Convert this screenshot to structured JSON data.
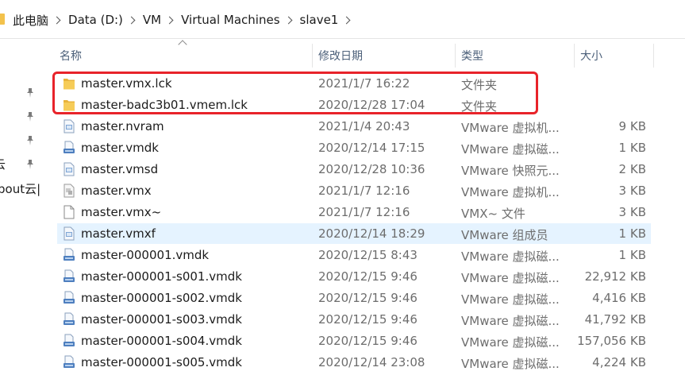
{
  "breadcrumb": [
    "此电脑",
    "Data (D:)",
    "VM",
    "Virtual Machines",
    "slave1"
  ],
  "nav_fragments": [
    "云",
    "bout云|"
  ],
  "columns": {
    "name": "名称",
    "date": "修改日期",
    "type": "类型",
    "size": "大小"
  },
  "files": [
    {
      "name": "master.vmx.lck",
      "date": "2021/1/7 16:22",
      "type": "文件夹",
      "size": "",
      "icon": "folder-icon"
    },
    {
      "name": "master-badc3b01.vmem.lck",
      "date": "2020/12/28 17:04",
      "type": "文件夹",
      "size": "",
      "icon": "folder-icon"
    },
    {
      "name": "master.nvram",
      "date": "2021/1/4 20:43",
      "type": "VMware 虚拟机...",
      "size": "9 KB",
      "icon": "vmware-file-icon"
    },
    {
      "name": "master.vmdk",
      "date": "2020/12/14 17:15",
      "type": "VMware 虚拟磁...",
      "size": "1 KB",
      "icon": "disk-file-icon"
    },
    {
      "name": "master.vmsd",
      "date": "2020/12/28 10:36",
      "type": "VMware 快照元...",
      "size": "2 KB",
      "icon": "vmware-file-icon"
    },
    {
      "name": "master.vmx",
      "date": "2021/1/7 12:16",
      "type": "VMware 虚拟机...",
      "size": "3 KB",
      "icon": "vmx-file-icon"
    },
    {
      "name": "master.vmx~",
      "date": "2021/1/7 12:16",
      "type": "VMX~ 文件",
      "size": "3 KB",
      "icon": "blank-file-icon"
    },
    {
      "name": "master.vmxf",
      "date": "2020/12/14 18:29",
      "type": "VMware 组成员",
      "size": "1 KB",
      "icon": "vmware-file-icon"
    },
    {
      "name": "master-000001.vmdk",
      "date": "2020/12/15 8:43",
      "type": "VMware 虚拟磁...",
      "size": "1 KB",
      "icon": "disk-file-icon"
    },
    {
      "name": "master-000001-s001.vmdk",
      "date": "2020/12/15 9:46",
      "type": "VMware 虚拟磁...",
      "size": "22,912 KB",
      "icon": "disk-file-icon"
    },
    {
      "name": "master-000001-s002.vmdk",
      "date": "2020/12/15 9:46",
      "type": "VMware 虚拟磁...",
      "size": "4,416 KB",
      "icon": "disk-file-icon"
    },
    {
      "name": "master-000001-s003.vmdk",
      "date": "2020/12/15 9:46",
      "type": "VMware 虚拟磁...",
      "size": "41,792 KB",
      "icon": "disk-file-icon"
    },
    {
      "name": "master-000001-s004.vmdk",
      "date": "2020/12/15 9:46",
      "type": "VMware 虚拟磁...",
      "size": "157,056 KB",
      "icon": "disk-file-icon"
    },
    {
      "name": "master-000001-s005.vmdk",
      "date": "2020/12/14 23:08",
      "type": "VMware 虚拟磁...",
      "size": "4,224 KB",
      "icon": "disk-file-icon"
    }
  ],
  "selected_row": 7,
  "colors": {
    "selection": "#e5f3ff",
    "highlight_box": "#e8232a",
    "folder": "#f3c24c",
    "header_text": "#4c607a"
  }
}
